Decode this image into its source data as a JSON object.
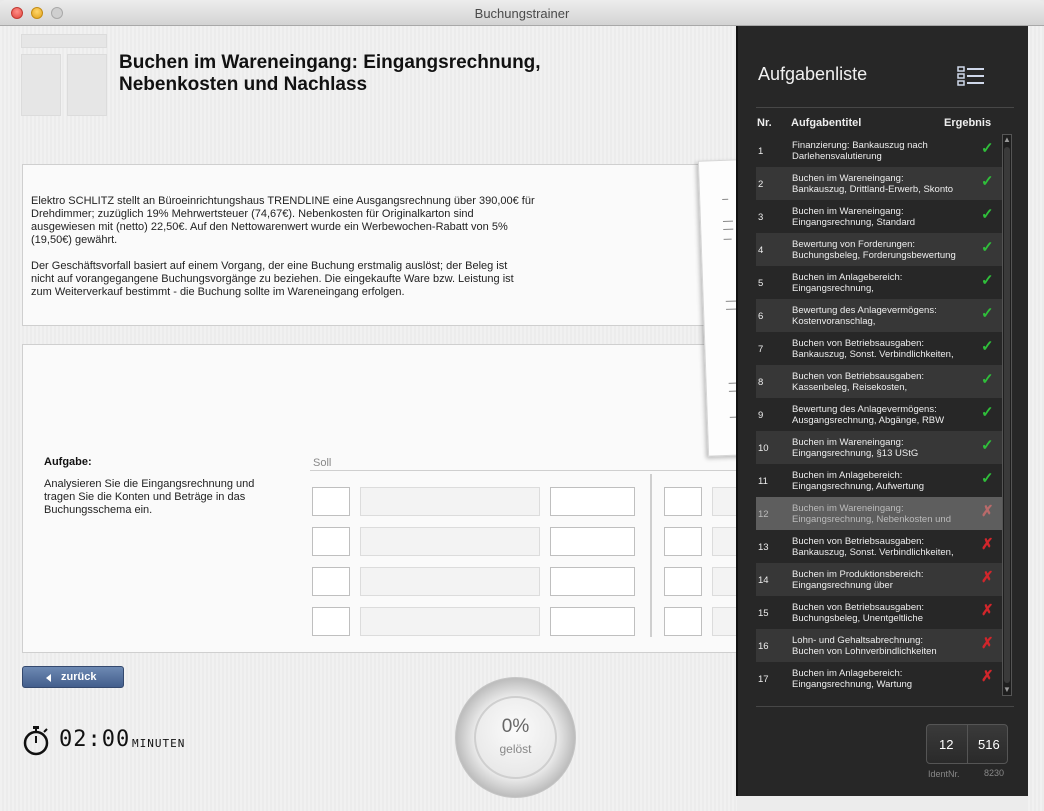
{
  "window": {
    "title": "Buchungstrainer"
  },
  "page": {
    "title_line1": "Buchen im Wareneingang: Eingangsrechnung,",
    "title_line2": "Nebenkosten und Nachlass"
  },
  "description": {
    "p1_lines": [
      "Elektro SCHLITZ stellt an Büroeinrichtungshaus TRENDLINE eine Ausgangsrechnung über 390,00€ für",
      "Drehdimmer; zuzüglich 19% Mehrwertsteuer (74,67€). Nebenkosten für Originalkarton sind",
      "ausgewiesen mit (netto) 22,50€. Auf den Nettowarenwert wurde ein Werbewochen-Rabatt von 5%",
      "(19,50€) gewährt."
    ],
    "p2_lines": [
      "Der Geschäftsvorfall basiert auf einem Vorgang, der eine Buchung erstmalig auslöst; der Beleg ist",
      "nicht auf vorangegangene Buchungsvorgänge zu beziehen. Die eingekaufte Ware bzw. Leistung ist",
      "zum Weiterverkauf bestimmt - die Buchung sollte im Wareneingang erfolgen."
    ]
  },
  "task": {
    "heading": "Aufgabe:",
    "text_lines": [
      "Analysieren Sie die Eingangsrechnung und",
      "tragen Sie die Konten und Beträge in das",
      "Buchungsschema ein."
    ],
    "soll_label": "Soll"
  },
  "back_button": {
    "label": "zurück"
  },
  "timer": {
    "time": "02:00",
    "unit": "MINUTEN"
  },
  "progress": {
    "percent": "0%",
    "label": "gelöst",
    "value": 0
  },
  "sidebar": {
    "title": "Aufgabenliste",
    "columns": {
      "nr": "Nr.",
      "title": "Aufgabentitel",
      "result": "Ergebnis"
    },
    "tasks": [
      {
        "nr": "1",
        "line1": "Finanzierung: Bankauszug nach",
        "line2": "Darlehensvalutierung",
        "result": "correct"
      },
      {
        "nr": "2",
        "line1": "Buchen im Wareneingang:",
        "line2": "Bankauszug, Drittland-Erwerb, Skonto",
        "result": "correct"
      },
      {
        "nr": "3",
        "line1": "Buchen im Wareneingang:",
        "line2": "Eingangsrechnung, Standard",
        "result": "correct"
      },
      {
        "nr": "4",
        "line1": "Bewertung von Forderungen:",
        "line2": "Buchungsbeleg, Forderungsbewertung",
        "result": "correct"
      },
      {
        "nr": "5",
        "line1": "Buchen im Anlagebereich:",
        "line2": "Eingangsrechnung,",
        "result": "correct"
      },
      {
        "nr": "6",
        "line1": "Bewertung des Anlagevermögens:",
        "line2": "Kostenvoranschlag,",
        "result": "correct"
      },
      {
        "nr": "7",
        "line1": "Buchen von Betriebsausgaben:",
        "line2": "Bankauszug, Sonst. Verbindlichkeiten,",
        "result": "correct"
      },
      {
        "nr": "8",
        "line1": "Buchen von Betriebsausgaben:",
        "line2": "Kassenbeleg, Reisekosten,",
        "result": "correct"
      },
      {
        "nr": "9",
        "line1": "Bewertung des Anlagevermögens:",
        "line2": "Ausgangsrechnung, Abgänge, RBW",
        "result": "correct"
      },
      {
        "nr": "10",
        "line1": "Buchen im Wareneingang:",
        "line2": "Eingangsrechnung, §13 UStG",
        "result": "correct"
      },
      {
        "nr": "11",
        "line1": "Buchen im Anlagebereich:",
        "line2": "Eingangsrechnung, Aufwertung",
        "result": "correct"
      },
      {
        "nr": "12",
        "line1": "Buchen im Wareneingang:",
        "line2": "Eingangsrechnung, Nebenkosten und",
        "result": "wrong"
      },
      {
        "nr": "13",
        "line1": "Buchen von Betriebsausgaben:",
        "line2": "Bankauszug, Sonst. Verbindlichkeiten,",
        "result": "wrong"
      },
      {
        "nr": "14",
        "line1": "Buchen im Produktionsbereich:",
        "line2": "Eingangsrechnung über",
        "result": "wrong"
      },
      {
        "nr": "15",
        "line1": "Buchen von Betriebsausgaben:",
        "line2": "Buchungsbeleg, Unentgeltliche",
        "result": "wrong"
      },
      {
        "nr": "16",
        "line1": "Lohn- und Gehaltsabrechnung:",
        "line2": "Buchen von Lohnverbindlichkeiten",
        "result": "wrong"
      },
      {
        "nr": "17",
        "line1": "Buchen im Anlagebereich:",
        "line2": "Eingangsrechnung, Wartung",
        "result": "wrong"
      }
    ],
    "selected_nr": "12",
    "ident": {
      "a": "12",
      "b": "516",
      "label": "IdentNr.",
      "number": "8230"
    }
  },
  "colors": {
    "correct": "#2fbf3a",
    "wrong": "#d1262b",
    "button": "#4f6b98"
  },
  "icons": {
    "list": "list-icon",
    "stopwatch": "stopwatch-icon",
    "check": "check-icon",
    "cross": "cross-icon"
  }
}
